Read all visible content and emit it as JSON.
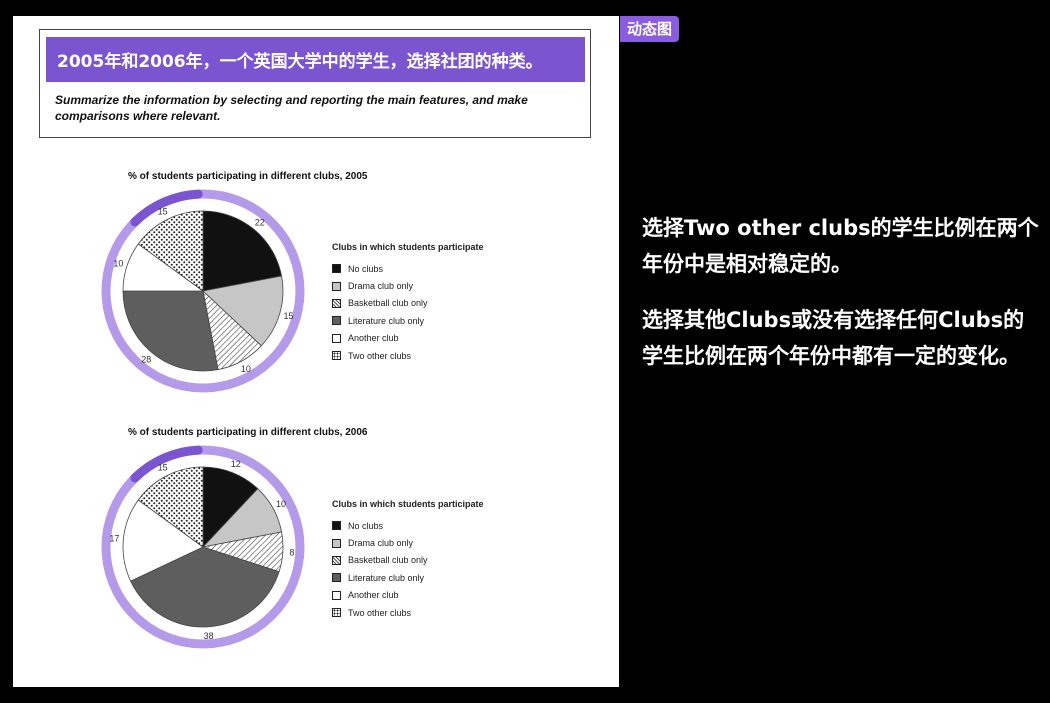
{
  "header": {
    "title": "2005年和2006年，一个英国大学中的学生，选择社团的种类。",
    "instructions": "Summarize the information by selecting and reporting the main features, and make comparisons where relevant."
  },
  "badge": "动态图",
  "commentary": {
    "paragraph_1": "选择Two other clubs的学生比例在两个年份中是相对稳定的。",
    "paragraph_2": "选择其他Clubs或没有选择任何Clubs的学生比例在两个年份中都有一定的变化。"
  },
  "colors": {
    "accent": "#7b54d0",
    "ring": "#b49ae8",
    "badge": "#8a5ce0",
    "no_clubs": "#111111",
    "drama": "#c6c6c6",
    "basketball": "hatch",
    "literature": "#5e5e5e",
    "another": "#ffffff",
    "two_other": "dots"
  },
  "chart_data": [
    {
      "type": "pie",
      "title": "% of students participating in different clubs, 2005",
      "legend_title": "Clubs in which students participate",
      "legend_position": "right",
      "slices": [
        {
          "label": "No clubs",
          "value": 22,
          "fill": "#111111"
        },
        {
          "label": "Drama club only",
          "value": 15,
          "fill": "#c6c6c6"
        },
        {
          "label": "Basketball club only",
          "value": 10,
          "fill": "hatch"
        },
        {
          "label": "Literature club only",
          "value": 28,
          "fill": "#5e5e5e"
        },
        {
          "label": "Another club",
          "value": 10,
          "fill": "#ffffff"
        },
        {
          "label": "Two other clubs",
          "value": 15,
          "fill": "dots"
        }
      ]
    },
    {
      "type": "pie",
      "title": "% of students participating in different clubs, 2006",
      "legend_title": "Clubs in which students participate",
      "legend_position": "right",
      "slices": [
        {
          "label": "No clubs",
          "value": 12,
          "fill": "#111111"
        },
        {
          "label": "Drama club only",
          "value": 10,
          "fill": "#c6c6c6"
        },
        {
          "label": "Basketball club only",
          "value": 8,
          "fill": "hatch"
        },
        {
          "label": "Literature club only",
          "value": 38,
          "fill": "#5e5e5e"
        },
        {
          "label": "Another club",
          "value": 17,
          "fill": "#ffffff"
        },
        {
          "label": "Two other clubs",
          "value": 15,
          "fill": "dots"
        }
      ]
    }
  ]
}
